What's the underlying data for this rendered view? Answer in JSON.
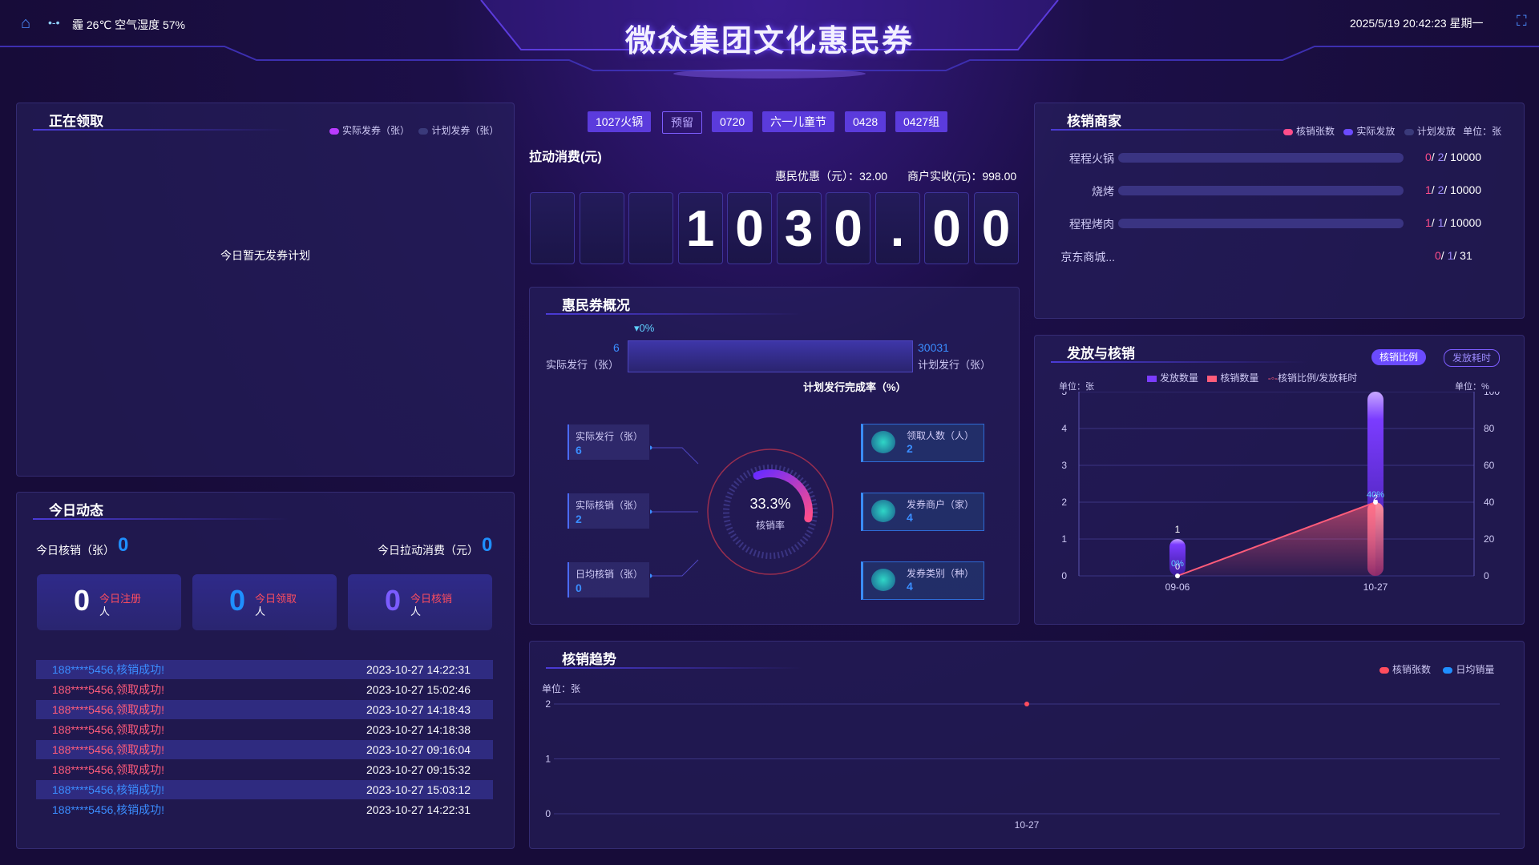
{
  "header": {
    "title": "微众集团文化惠民券",
    "weather": "霾 26℃ 空气湿度 57%",
    "datetime": "2025/5/19 20:42:23 星期一"
  },
  "receiving": {
    "title": "正在领取",
    "legend": [
      "实际发券（张）",
      "计划发券（张）"
    ],
    "empty": "今日暂无发券计划"
  },
  "today": {
    "title": "今日动态",
    "writeoff_label": "今日核销（张）",
    "writeoff_value": "0",
    "consume_label": "今日拉动消费（元）",
    "consume_value": "0",
    "stats": [
      {
        "value": "0",
        "label": "今日注册",
        "unit": "人"
      },
      {
        "value": "0",
        "label": "今日领取",
        "unit": "人"
      },
      {
        "value": "0",
        "label": "今日核销",
        "unit": "人"
      }
    ],
    "feed": [
      {
        "text": "188****5456,核销成功!",
        "time": "2023-10-27 14:22:31",
        "color": "#3a8dff"
      },
      {
        "text": "188****5456,领取成功!",
        "time": "2023-10-27 15:02:46",
        "color": "#ff5c7a"
      },
      {
        "text": "188****5456,领取成功!",
        "time": "2023-10-27 14:18:43",
        "color": "#ff5c7a"
      },
      {
        "text": "188****5456,领取成功!",
        "time": "2023-10-27 14:18:38",
        "color": "#ff5c7a"
      },
      {
        "text": "188****5456,领取成功!",
        "time": "2023-10-27 09:16:04",
        "color": "#ff5c7a"
      },
      {
        "text": "188****5456,领取成功!",
        "time": "2023-10-27 09:15:32",
        "color": "#ff5c7a"
      },
      {
        "text": "188****5456,核销成功!",
        "time": "2023-10-27 15:03:12",
        "color": "#3a8dff"
      },
      {
        "text": "188****5456,核销成功!",
        "time": "2023-10-27 14:22:31",
        "color": "#3a8dff"
      }
    ]
  },
  "center": {
    "chips": [
      {
        "label": "1027火锅",
        "outline": false
      },
      {
        "label": "预留",
        "outline": true
      },
      {
        "label": "0720",
        "outline": false
      },
      {
        "label": "六一儿童节",
        "outline": false
      },
      {
        "label": "0428",
        "outline": false
      },
      {
        "label": "0427组",
        "outline": false
      }
    ],
    "consume_title": "拉动消费(元)",
    "discount": "惠民优惠（元）：32.00",
    "merchant": "商户实收(元)：998.00",
    "digits": [
      "",
      "",
      "",
      "1",
      "0",
      "3",
      "0",
      ".",
      "0",
      "0"
    ],
    "overview_title": "惠民券概况",
    "completion_pct": "0%",
    "actual_issue": "6",
    "actual_issue_label": "实际发行（张）",
    "plan_issue": "30031",
    "plan_issue_label": "计划发行（张）",
    "completion_label": "计划发行完成率（%）",
    "completion_fraction": 0.0002,
    "gauge_value": "33.3%",
    "gauge_label": "核销率",
    "gauge_fraction": 0.333,
    "left_stats": [
      {
        "label": "实际发行（张）",
        "value": "6"
      },
      {
        "label": "实际核销（张）",
        "value": "2"
      },
      {
        "label": "日均核销（张）",
        "value": "0"
      }
    ],
    "right_stats": [
      {
        "label": "领取人数（人）",
        "value": "2",
        "icon": "people-icon"
      },
      {
        "label": "发券商户（家）",
        "value": "4",
        "icon": "shop-icon"
      },
      {
        "label": "发券类别（种）",
        "value": "4",
        "icon": "category-icon"
      }
    ]
  },
  "merchants": {
    "title": "核销商家",
    "legend": [
      "核销张数",
      "实际发放",
      "计划发放"
    ],
    "unit": "单位：张",
    "rows": [
      {
        "name": "程程火锅",
        "a": "0",
        "b": "2",
        "c": "10000"
      },
      {
        "name": "烧烤",
        "a": "1",
        "b": "2",
        "c": "10000"
      },
      {
        "name": "程程烤肉",
        "a": "1",
        "b": "1",
        "c": "10000"
      },
      {
        "name": "京东商城...",
        "a": "0",
        "b": "1",
        "c": "31"
      }
    ]
  },
  "issue": {
    "title": "发放与核销",
    "tabs": [
      "核销比例",
      "发放耗时"
    ],
    "legend": [
      "发放数量",
      "核销数量",
      "核销比例/发放耗时"
    ],
    "unit_left": "单位：张",
    "unit_right": "单位：%"
  },
  "trend": {
    "title": "核销趋势",
    "legend": [
      "核销张数",
      "日均销量"
    ],
    "unit": "单位：张"
  },
  "chart_data": [
    {
      "type": "bar",
      "title": "发放与核销",
      "categories": [
        "09-06",
        "10-27"
      ],
      "series": [
        {
          "name": "发放数量",
          "values": [
            1,
            5
          ],
          "color": "#7b3cff"
        },
        {
          "name": "核销数量",
          "values": [
            0,
            2
          ],
          "color": "#ff5c7a"
        },
        {
          "name": "核销比例/发放耗时",
          "values": [
            0,
            40
          ],
          "color": "#ff5c7a",
          "axis": "right",
          "labels": [
            "0%",
            "40%"
          ]
        }
      ],
      "ylim": [
        0,
        5
      ],
      "y2lim": [
        0,
        100
      ],
      "yticks": [
        0,
        1,
        2,
        3,
        4,
        5
      ],
      "y2ticks": [
        0,
        20,
        40,
        60,
        80,
        100
      ]
    },
    {
      "type": "line",
      "title": "核销趋势",
      "categories": [
        "10-27"
      ],
      "series": [
        {
          "name": "核销张数",
          "values": [
            2
          ],
          "color": "#ff4d5e"
        },
        {
          "name": "日均销量",
          "values": [],
          "color": "#1f8fff"
        }
      ],
      "ylim": [
        0,
        2
      ],
      "yticks": [
        0,
        1,
        2
      ]
    }
  ]
}
